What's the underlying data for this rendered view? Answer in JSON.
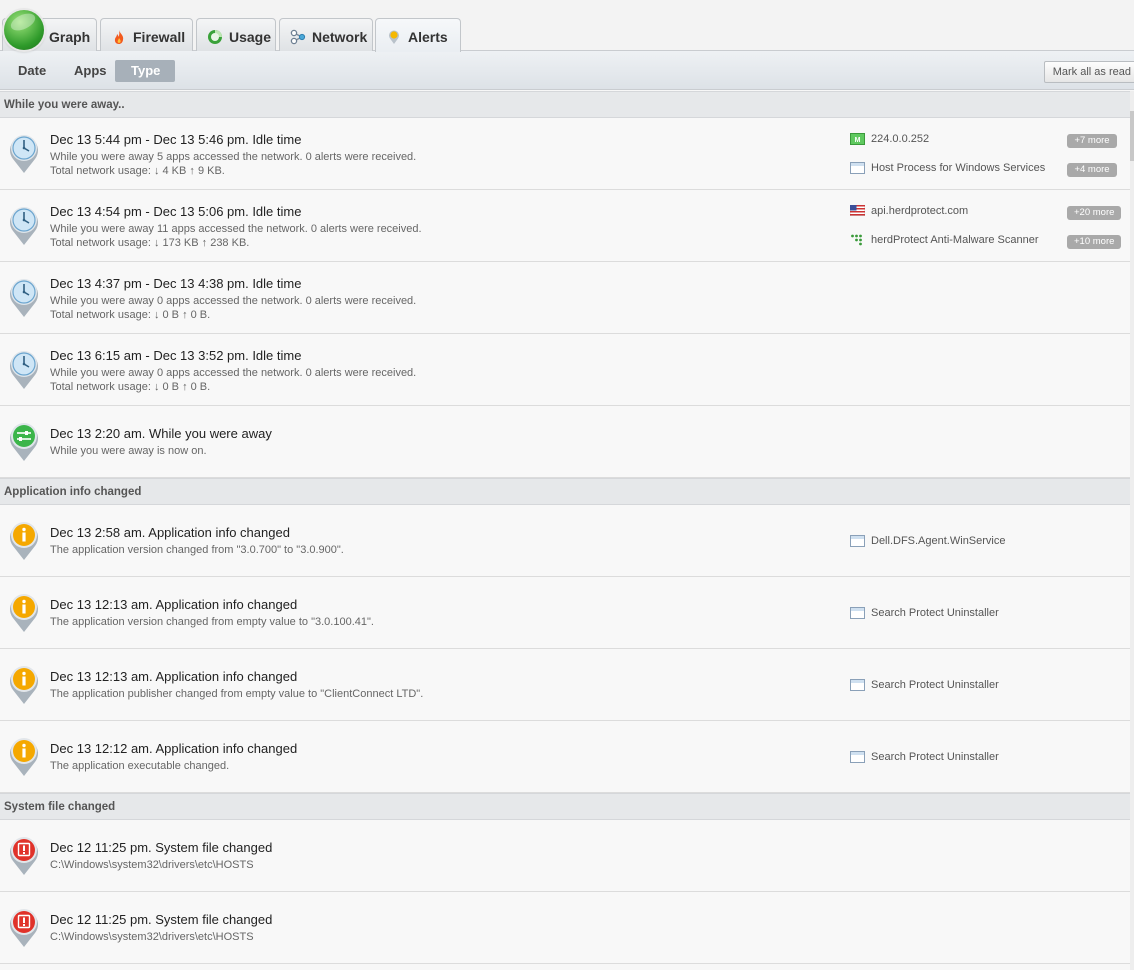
{
  "tabs": [
    {
      "label": "Graph",
      "icon": "graph-logo-icon"
    },
    {
      "label": "Firewall",
      "icon": "fire-icon"
    },
    {
      "label": "Usage",
      "icon": "pie-icon"
    },
    {
      "label": "Network",
      "icon": "network-nodes-icon"
    },
    {
      "label": "Alerts",
      "icon": "alert-pin-icon"
    }
  ],
  "subtabs": [
    "Date",
    "Apps",
    "Type"
  ],
  "mark_all_label": "Mark all as read",
  "sections": [
    {
      "heading": "While you were away..",
      "rows": [
        {
          "title": "Dec 13 5:44 pm - Dec 13 5:46 pm. Idle time",
          "line1": "While you were away 5 apps accessed the network. 0 alerts were received.",
          "line2": "Total network usage:  ↓ 4 KB   ↑ 9 KB.",
          "side": [
            {
              "text": "224.0.0.252",
              "icon": "multicast-icon",
              "badge": "+7 more"
            },
            {
              "text": "Host Process for Windows Services",
              "icon": "app-window-icon",
              "badge": "+4 more"
            }
          ]
        },
        {
          "title": "Dec 13 4:54 pm - Dec 13 5:06 pm. Idle time",
          "line1": "While you were away 11 apps accessed the network. 0 alerts were received.",
          "line2": "Total network usage:  ↓ 173 KB   ↑ 238 KB.",
          "side": [
            {
              "text": "api.herdprotect.com",
              "icon": "us-flag-icon",
              "badge": "+20 more"
            },
            {
              "text": "herdProtect Anti-Malware Scanner",
              "icon": "herdprotect-icon",
              "badge": "+10 more"
            }
          ]
        },
        {
          "title": "Dec 13 4:37 pm - Dec 13 4:38 pm. Idle time",
          "line1": "While you were away 0 apps accessed the network. 0 alerts were received.",
          "line2": "Total network usage:  ↓ 0 B   ↑ 0 B."
        },
        {
          "title": "Dec 13 6:15 am - Dec 13 3:52 pm. Idle time",
          "line1": "While you were away 0 apps accessed the network. 0 alerts were received.",
          "line2": "Total network usage:  ↓ 0 B   ↑ 0 B."
        },
        {
          "title": "Dec 13 2:20 am. While you were away",
          "line1": "While you were away is now on."
        }
      ]
    },
    {
      "heading": "Application info changed",
      "rows": [
        {
          "title": "Dec 13 2:58 am. Application info changed",
          "line1": "The application version changed from \"3.0.700\" to \"3.0.900\".",
          "side": [
            {
              "text": "Dell.DFS.Agent.WinService",
              "icon": "app-window-icon"
            }
          ]
        },
        {
          "title": "Dec 13 12:13 am. Application info changed",
          "line1": "The application version changed from empty value to \"3.0.100.41\".",
          "side": [
            {
              "text": "Search Protect Uninstaller",
              "icon": "app-window-icon"
            }
          ]
        },
        {
          "title": "Dec 13 12:13 am. Application info changed",
          "line1": "The application publisher changed from empty value to \"ClientConnect LTD\".",
          "side": [
            {
              "text": "Search Protect Uninstaller",
              "icon": "app-window-icon"
            }
          ]
        },
        {
          "title": "Dec 13 12:12 am. Application info changed",
          "line1": "The application executable changed.",
          "side": [
            {
              "text": "Search Protect Uninstaller",
              "icon": "app-window-icon"
            }
          ]
        }
      ]
    },
    {
      "heading": "System file changed",
      "rows": [
        {
          "title": "Dec 12 11:25 pm. System file changed",
          "line1": "C:\\Windows\\system32\\drivers\\etc\\HOSTS"
        },
        {
          "title": "Dec 12 11:25 pm. System file changed",
          "line1": "C:\\Windows\\system32\\drivers\\etc\\HOSTS"
        }
      ]
    }
  ],
  "row_icons": {
    "idle": "clock-pin-icon",
    "away": "toggle-pin-icon",
    "info": "info-pin-icon",
    "system": "warning-pin-icon"
  },
  "colors": {
    "accent": "#3a78b5",
    "info": "#f5a800",
    "system": "#e0322a",
    "away": "#3bb54a",
    "idle": "#8fc6e8"
  }
}
